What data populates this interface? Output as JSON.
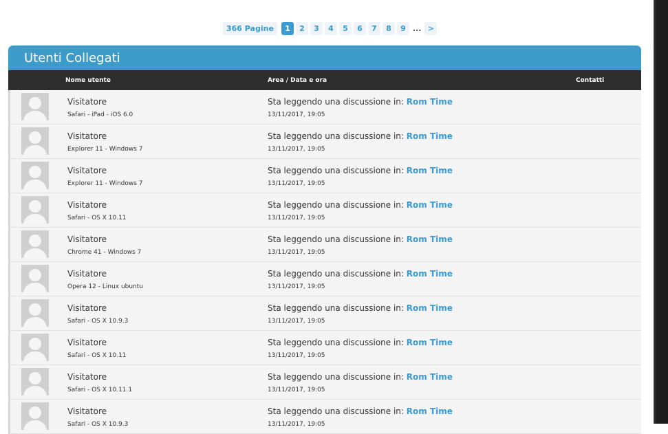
{
  "pagination": {
    "total_label": "366 Pagine",
    "pages": [
      "1",
      "2",
      "3",
      "4",
      "5",
      "6",
      "7",
      "8",
      "9"
    ],
    "current": "1",
    "ellipsis": "...",
    "next": ">"
  },
  "panel": {
    "title": "Utenti Collegati",
    "columns": {
      "user": "Nome utente",
      "area": "Area / Data e ora",
      "contacts": "Contatti"
    }
  },
  "rows": [
    {
      "name": "Visitatore",
      "ua": "Safari - iPad - iOS 6.0",
      "activity": "Sta leggendo una discussione in:",
      "link": "Rom Time",
      "time": "13/11/2017, 19:05"
    },
    {
      "name": "Visitatore",
      "ua": "Explorer 11 - Windows 7",
      "activity": "Sta leggendo una discussione in:",
      "link": "Rom Time",
      "time": "13/11/2017, 19:05"
    },
    {
      "name": "Visitatore",
      "ua": "Explorer 11 - Windows 7",
      "activity": "Sta leggendo una discussione in:",
      "link": "Rom Time",
      "time": "13/11/2017, 19:05"
    },
    {
      "name": "Visitatore",
      "ua": "Safari - OS X 10.11",
      "activity": "Sta leggendo una discussione in:",
      "link": "Rom Time",
      "time": "13/11/2017, 19:05"
    },
    {
      "name": "Visitatore",
      "ua": "Chrome 41 - Windows 7",
      "activity": "Sta leggendo una discussione in:",
      "link": "Rom Time",
      "time": "13/11/2017, 19:05"
    },
    {
      "name": "Visitatore",
      "ua": "Opera 12 - Linux ubuntu",
      "activity": "Sta leggendo una discussione in:",
      "link": "Rom Time",
      "time": "13/11/2017, 19:05"
    },
    {
      "name": "Visitatore",
      "ua": "Safari - OS X 10.9.3",
      "activity": "Sta leggendo una discussione in:",
      "link": "Rom Time",
      "time": "13/11/2017, 19:05"
    },
    {
      "name": "Visitatore",
      "ua": "Safari - OS X 10.11",
      "activity": "Sta leggendo una discussione in:",
      "link": "Rom Time",
      "time": "13/11/2017, 19:05"
    },
    {
      "name": "Visitatore",
      "ua": "Safari - OS X 10.11.1",
      "activity": "Sta leggendo una discussione in:",
      "link": "Rom Time",
      "time": "13/11/2017, 19:05"
    },
    {
      "name": "Visitatore",
      "ua": "Safari - OS X 10.9.3",
      "activity": "Sta leggendo una discussione in:",
      "link": "Rom Time",
      "time": "13/11/2017, 19:05"
    }
  ]
}
